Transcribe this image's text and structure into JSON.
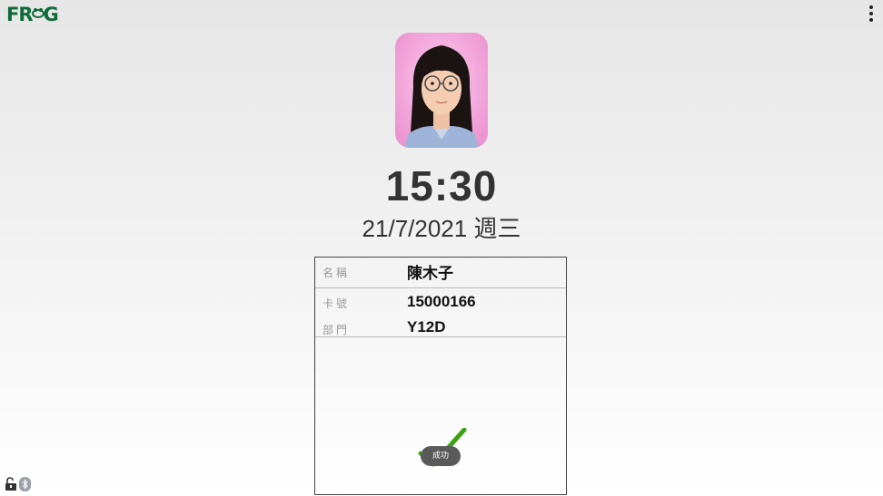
{
  "header": {
    "logo_text_left": "FR",
    "logo_text_right": "G",
    "logo_mark_icon": "frog-icon",
    "menu_icon": "more-vertical-icon"
  },
  "profile": {
    "photo_description_icon": "user-photo"
  },
  "clock": {
    "time": "15:30",
    "date": "21/7/2021 週三"
  },
  "info": {
    "name_label": "名稱",
    "name_value": "陳木子",
    "card_label": "卡號",
    "card_value": "15000166",
    "dept_label": "部門",
    "dept_value": "Y12D"
  },
  "status": {
    "check_icon": "checkmark-icon",
    "toast_text": "成功"
  },
  "footer": {
    "lock_icon": "unlocked-padlock-icon",
    "bluetooth_icon": "bluetooth-icon"
  },
  "colors": {
    "brand_green": "#0f6b3a",
    "check_green": "#3aa312",
    "photo_bg": "#f3a9dc"
  }
}
